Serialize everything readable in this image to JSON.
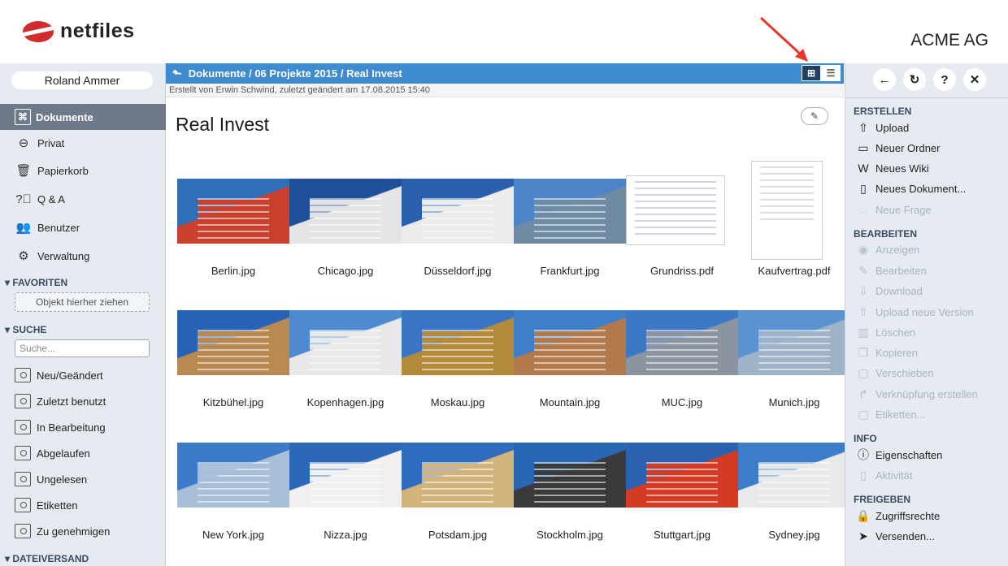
{
  "header": {
    "logo_text": "netfiles",
    "company": "ACME AG"
  },
  "sidebar": {
    "user": "Roland Ammer",
    "nav": [
      {
        "label": "Dokumente",
        "icon": "documents-icon",
        "active": true
      },
      {
        "label": "Privat",
        "icon": "private-folder-icon"
      },
      {
        "label": "Papierkorb",
        "icon": "trash-icon"
      },
      {
        "label": "Q & A",
        "icon": "question-icon"
      },
      {
        "label": "Benutzer",
        "icon": "users-icon"
      },
      {
        "label": "Verwaltung",
        "icon": "gear-icon"
      }
    ],
    "favorites_header": "FAVORITEN",
    "favorites_drop": "Objekt hierher ziehen",
    "search_header": "SUCHE",
    "search_placeholder": "Suche...",
    "searches": [
      "Neu/Geändert",
      "Zuletzt benutzt",
      "In Bearbeitung",
      "Abgelaufen",
      "Ungelesen",
      "Etiketten",
      "Zu genehmigen"
    ],
    "dateiversand_header": "DATEIVERSAND"
  },
  "main": {
    "path": "Dokumente / 06 Projekte 2015 / Real Invest",
    "meta": "Erstellt von Erwin Schwind, zuletzt geändert am 17.08.2015 15:40",
    "folder_title": "Real Invest",
    "files": [
      {
        "name": "Berlin.jpg",
        "c1": "#2f6fb8",
        "c2": "#c9402e"
      },
      {
        "name": "Chicago.jpg",
        "c1": "#1f4f9a",
        "c2": "#e4e4e4"
      },
      {
        "name": "Düsseldorf.jpg",
        "c1": "#2a5fae",
        "c2": "#ececec"
      },
      {
        "name": "Frankfurt.jpg",
        "c1": "#4d84c8",
        "c2": "#6f8aa3"
      },
      {
        "name": "Grundriss.pdf",
        "c1": "#ffffff",
        "c2": "#cfd6df"
      },
      {
        "name": "Kaufvertrag.pdf",
        "c1": "#ffffff",
        "c2": "#dddddd"
      },
      {
        "name": "Kitzbühel.jpg",
        "c1": "#2862b4",
        "c2": "#b88a52"
      },
      {
        "name": "Kopenhagen.jpg",
        "c1": "#4f8ad1",
        "c2": "#e8e8e8"
      },
      {
        "name": "Moskau.jpg",
        "c1": "#3a74c4",
        "c2": "#b38a3a"
      },
      {
        "name": "Mountain.jpg",
        "c1": "#3f7fc9",
        "c2": "#b27a4c"
      },
      {
        "name": "MUC.jpg",
        "c1": "#3d78c5",
        "c2": "#8b95a0"
      },
      {
        "name": "Munich.jpg",
        "c1": "#5a92d2",
        "c2": "#9fb3c8"
      },
      {
        "name": "New York.jpg",
        "c1": "#3d7bc8",
        "c2": "#a7c0d8"
      },
      {
        "name": "Nizza.jpg",
        "c1": "#2d68b8",
        "c2": "#f0f0f0"
      },
      {
        "name": "Potsdam.jpg",
        "c1": "#2f6cbd",
        "c2": "#d2b37a"
      },
      {
        "name": "Stockholm.jpg",
        "c1": "#2966b6",
        "c2": "#3a3a3a"
      },
      {
        "name": "Stuttgart.jpg",
        "c1": "#2a62b0",
        "c2": "#d53a24"
      },
      {
        "name": "Sydney.jpg",
        "c1": "#3b7dc8",
        "c2": "#e9e9e9"
      }
    ]
  },
  "right": {
    "tools": [
      {
        "icon": "back-arrow-icon",
        "glyph": "←"
      },
      {
        "icon": "refresh-icon",
        "glyph": "↻"
      },
      {
        "icon": "help-icon",
        "glyph": "?"
      },
      {
        "icon": "close-icon",
        "glyph": "✕"
      }
    ],
    "erstellen_header": "ERSTELLEN",
    "erstellen": [
      {
        "label": "Upload",
        "icon": "upload-icon",
        "glyph": "⇧",
        "enabled": true
      },
      {
        "label": "Neuer Ordner",
        "icon": "new-folder-icon",
        "glyph": "▭",
        "enabled": true
      },
      {
        "label": "Neues Wiki",
        "icon": "wiki-icon",
        "glyph": "W",
        "enabled": true
      },
      {
        "label": "Neues Dokument...",
        "icon": "new-document-icon",
        "glyph": "▯",
        "enabled": true
      },
      {
        "label": "Neue Frage",
        "icon": "new-question-icon",
        "glyph": "◌",
        "enabled": false
      }
    ],
    "bearbeiten_header": "BEARBEITEN",
    "bearbeiten": [
      {
        "label": "Anzeigen",
        "icon": "eye-icon",
        "glyph": "◉"
      },
      {
        "label": "Bearbeiten",
        "icon": "pencil-icon",
        "glyph": "✎"
      },
      {
        "label": "Download",
        "icon": "download-icon",
        "glyph": "⇩"
      },
      {
        "label": "Upload neue Version",
        "icon": "upload-version-icon",
        "glyph": "⇧"
      },
      {
        "label": "Löschen",
        "icon": "trash-icon",
        "glyph": "▥"
      },
      {
        "label": "Kopieren",
        "icon": "copy-icon",
        "glyph": "❐"
      },
      {
        "label": "Verschieben",
        "icon": "move-icon",
        "glyph": "▢"
      },
      {
        "label": "Verknüpfung erstellen",
        "icon": "link-icon",
        "glyph": "↱"
      },
      {
        "label": "Etiketten...",
        "icon": "tag-icon",
        "glyph": "▢"
      }
    ],
    "info_header": "INFO",
    "info": [
      {
        "label": "Eigenschaften",
        "icon": "info-icon",
        "glyph": "ⓘ",
        "enabled": true
      },
      {
        "label": "Aktivität",
        "icon": "activity-icon",
        "glyph": "▯",
        "enabled": false
      }
    ],
    "freigeben_header": "FREIGEBEN",
    "freigeben": [
      {
        "label": "Zugriffsrechte",
        "icon": "lock-icon",
        "glyph": "🔒",
        "enabled": true
      },
      {
        "label": "Versenden...",
        "icon": "send-icon",
        "glyph": "➤",
        "enabled": true
      }
    ]
  }
}
